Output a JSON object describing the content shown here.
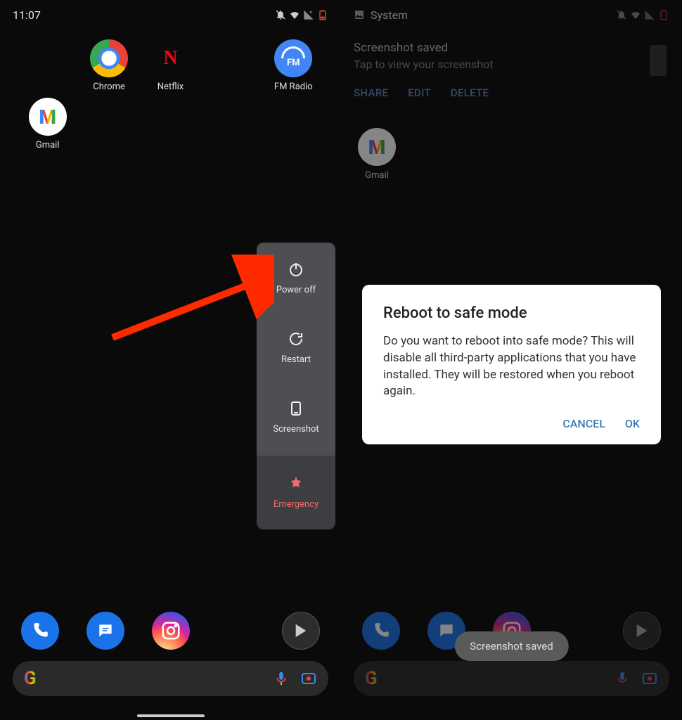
{
  "left": {
    "status": {
      "time": "11:07"
    },
    "apps": [
      {
        "name": "Chrome"
      },
      {
        "name": "Netflix"
      },
      {
        "name": "FM Radio"
      },
      {
        "name": "Gmail"
      }
    ],
    "power_menu": {
      "power_off": "Power off",
      "restart": "Restart",
      "screenshot": "Screenshot",
      "emergency": "Emergency"
    }
  },
  "right": {
    "status": {
      "app": "System"
    },
    "notification": {
      "title": "Screenshot saved",
      "subtitle": "Tap to view your screenshot",
      "share": "SHARE",
      "edit": "EDIT",
      "delete": "DELETE"
    },
    "apps": [
      {
        "name": "Gmail"
      }
    ],
    "dialog": {
      "title": "Reboot to safe mode",
      "body": "Do you want to reboot into safe mode? This will disable all third-party applications that you have installed. They will be restored when you reboot again.",
      "cancel": "CANCEL",
      "ok": "OK"
    },
    "toast": "Screenshot saved"
  }
}
